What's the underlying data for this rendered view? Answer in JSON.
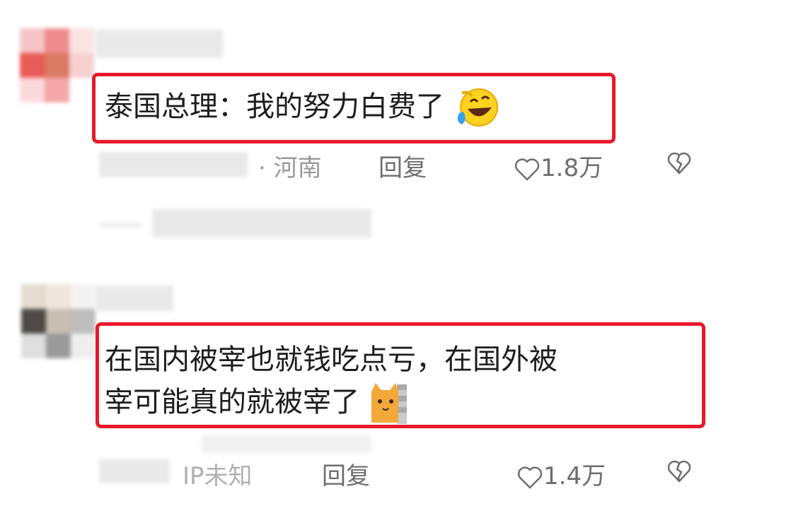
{
  "comments": [
    {
      "text": "泰国总理：我的努力白费了",
      "location": "河南",
      "reply_label": "回复",
      "like_count": "1.8万",
      "emoji": "laughing-crying-emoji"
    },
    {
      "text_line1": "在国内被宰也就钱吃点亏，在国外被",
      "text_line2": "宰可能真的就被宰了",
      "location": "IP未知",
      "reply_label": "回复",
      "like_count": "1.4万",
      "emoji": "cat-peeking-emoji"
    }
  ],
  "colors": {
    "highlight_border": "#e8192c",
    "meta_text": "#9a9a9a"
  }
}
